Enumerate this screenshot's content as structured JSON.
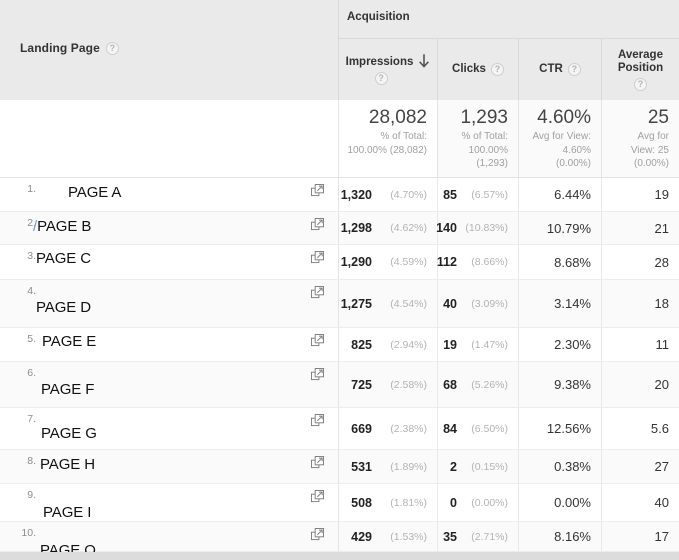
{
  "dimension_header": {
    "label": "Landing Page",
    "help": "?"
  },
  "group_header": {
    "label": "Acquisition"
  },
  "metric_headers": [
    {
      "label": "Impressions",
      "help": "?",
      "sorted": "desc"
    },
    {
      "label": "Clicks",
      "help": "?",
      "sorted": ""
    },
    {
      "label": "CTR",
      "help": "?",
      "sorted": ""
    },
    {
      "label": "Average Position",
      "help": "?",
      "sorted": ""
    }
  ],
  "summary": {
    "impressions": {
      "value": "28,082",
      "sub_line1": "% of Total:",
      "sub_line2": "100.00% (28,082)"
    },
    "clicks": {
      "value": "1,293",
      "sub_line1": "% of Total:",
      "sub_line2": "100.00%",
      "sub_line3": "(1,293)"
    },
    "ctr": {
      "value": "4.60%",
      "sub_line1": "Avg for View:",
      "sub_line2": "4.60%",
      "sub_line3": "(0.00%)"
    },
    "avg_position": {
      "value": "25",
      "sub_line1": "Avg for",
      "sub_line2": "View: 25",
      "sub_line3": "(0.00%)"
    }
  },
  "rows": [
    {
      "index": "1.",
      "page": "PAGE A",
      "prefix": "",
      "impressions": "1,320",
      "impressions_pct": "(4.70%)",
      "clicks": "85",
      "clicks_pct": "(6.57%)",
      "ctr": "6.44%",
      "avg_position": "19"
    },
    {
      "index": "2.",
      "page": "PAGE B",
      "prefix": "/",
      "impressions": "1,298",
      "impressions_pct": "(4.62%)",
      "clicks": "140",
      "clicks_pct": "(10.83%)",
      "ctr": "10.79%",
      "avg_position": "21"
    },
    {
      "index": "3.",
      "page": "PAGE C",
      "prefix": "",
      "impressions": "1,290",
      "impressions_pct": "(4.59%)",
      "clicks": "112",
      "clicks_pct": "(8.66%)",
      "ctr": "8.68%",
      "avg_position": "28"
    },
    {
      "index": "4.",
      "page": "PAGE D",
      "prefix": "",
      "impressions": "1,275",
      "impressions_pct": "(4.54%)",
      "clicks": "40",
      "clicks_pct": "(3.09%)",
      "ctr": "3.14%",
      "avg_position": "18"
    },
    {
      "index": "5.",
      "page": "PAGE E",
      "prefix": "",
      "impressions": "825",
      "impressions_pct": "(2.94%)",
      "clicks": "19",
      "clicks_pct": "(1.47%)",
      "ctr": "2.30%",
      "avg_position": "11"
    },
    {
      "index": "6.",
      "page": "PAGE F",
      "prefix": "",
      "impressions": "725",
      "impressions_pct": "(2.58%)",
      "clicks": "68",
      "clicks_pct": "(5.26%)",
      "ctr": "9.38%",
      "avg_position": "20"
    },
    {
      "index": "7.",
      "page": "PAGE G",
      "prefix": "",
      "impressions": "669",
      "impressions_pct": "(2.38%)",
      "clicks": "84",
      "clicks_pct": "(6.50%)",
      "ctr": "12.56%",
      "avg_position": "5.6"
    },
    {
      "index": "8.",
      "page": "PAGE H",
      "prefix": "",
      "impressions": "531",
      "impressions_pct": "(1.89%)",
      "clicks": "2",
      "clicks_pct": "(0.15%)",
      "ctr": "0.38%",
      "avg_position": "27"
    },
    {
      "index": "9.",
      "page": "PAGE I",
      "prefix": "",
      "impressions": "508",
      "impressions_pct": "(1.81%)",
      "clicks": "0",
      "clicks_pct": "(0.00%)",
      "ctr": "0.00%",
      "avg_position": "40"
    },
    {
      "index": "10.",
      "page": "PAGE Q",
      "prefix": "",
      "impressions": "429",
      "impressions_pct": "(1.53%)",
      "clicks": "35",
      "clicks_pct": "(2.71%)",
      "ctr": "8.16%",
      "avg_position": "17"
    }
  ],
  "icons": {
    "external_link": "open-in-new-icon",
    "sort_desc": "arrow-down-icon",
    "help": "help-icon"
  },
  "colors": {
    "header_bg": "#eaeaea",
    "row_alt_bg": "#fafafa",
    "text_primary": "#222222",
    "text_muted": "#b3b3b3",
    "link_blue": "#6f9fe0",
    "border": "#e4e4e4"
  }
}
